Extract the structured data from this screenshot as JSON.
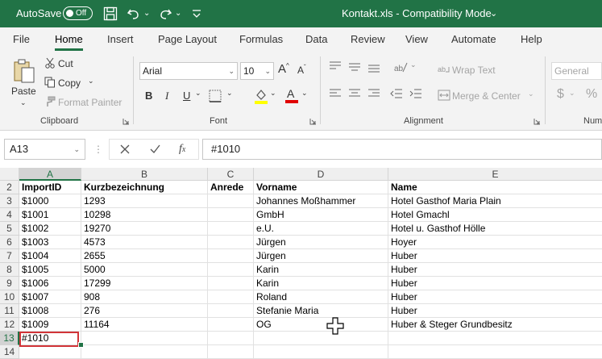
{
  "titlebar": {
    "autosave_label": "AutoSave",
    "autosave_state": "Off",
    "file_title": "Kontakt.xls  -  Compatibility Mode",
    "title_caret": "⌄",
    "bg_color": "#217346"
  },
  "tabs": [
    {
      "label": "File"
    },
    {
      "label": "Home"
    },
    {
      "label": "Insert"
    },
    {
      "label": "Page Layout"
    },
    {
      "label": "Formulas"
    },
    {
      "label": "Data"
    },
    {
      "label": "Review"
    },
    {
      "label": "View"
    },
    {
      "label": "Automate"
    },
    {
      "label": "Help"
    }
  ],
  "active_tab": "Home",
  "ribbon": {
    "clipboard": {
      "group_label": "Clipboard",
      "paste": "Paste",
      "cut": "Cut",
      "copy": "Copy",
      "format_painter": "Format Painter"
    },
    "font": {
      "group_label": "Font",
      "font_name": "Arial",
      "font_size": "10",
      "bold": "B",
      "italic": "I",
      "underline": "U"
    },
    "alignment": {
      "group_label": "Alignment",
      "wrap_text": "Wrap Text",
      "merge_center": "Merge & Center"
    },
    "number": {
      "group_label": "Num",
      "format": "General",
      "currency": "$",
      "percent": "%"
    }
  },
  "formula_bar": {
    "name_box": "A13",
    "formula": "#1010"
  },
  "grid": {
    "columns": [
      "A",
      "B",
      "C",
      "D",
      "E"
    ],
    "rows": [
      {
        "num": "2",
        "cells": [
          "ImportID",
          "Kurzbezeichnung",
          "Anrede",
          "Vorname",
          "Name"
        ],
        "header": true
      },
      {
        "num": "3",
        "cells": [
          "$1000",
          "1293",
          "",
          "Johannes Moßhammer",
          "Hotel Gasthof Maria Plain"
        ]
      },
      {
        "num": "4",
        "cells": [
          "$1001",
          "10298",
          "",
          "GmbH",
          "Hotel Gmachl"
        ]
      },
      {
        "num": "5",
        "cells": [
          "$1002",
          "19270",
          "",
          "e.U.",
          "Hotel u. Gasthof Hölle"
        ]
      },
      {
        "num": "6",
        "cells": [
          "$1003",
          "4573",
          "",
          "Jürgen",
          "Hoyer"
        ]
      },
      {
        "num": "7",
        "cells": [
          "$1004",
          "2655",
          "",
          "Jürgen",
          "Huber"
        ]
      },
      {
        "num": "8",
        "cells": [
          "$1005",
          "5000",
          "",
          "Karin",
          "Huber"
        ]
      },
      {
        "num": "9",
        "cells": [
          "$1006",
          "17299",
          "",
          "Karin",
          "Huber"
        ]
      },
      {
        "num": "10",
        "cells": [
          "$1007",
          "908",
          "",
          "Roland",
          "Huber"
        ]
      },
      {
        "num": "11",
        "cells": [
          "$1008",
          "276",
          "",
          "Stefanie Maria",
          "Huber"
        ]
      },
      {
        "num": "12",
        "cells": [
          "$1009",
          "11164",
          "",
          "OG",
          "Huber & Steger Grundbesitz"
        ]
      },
      {
        "num": "13",
        "cells": [
          "#1010",
          "",
          "",
          "",
          ""
        ]
      },
      {
        "num": "14",
        "cells": [
          "",
          "",
          "",
          "",
          ""
        ]
      }
    ],
    "selected_column": "A",
    "selected_row": "13",
    "accent_color": "#217346",
    "edit_border_color": "#d13438"
  }
}
